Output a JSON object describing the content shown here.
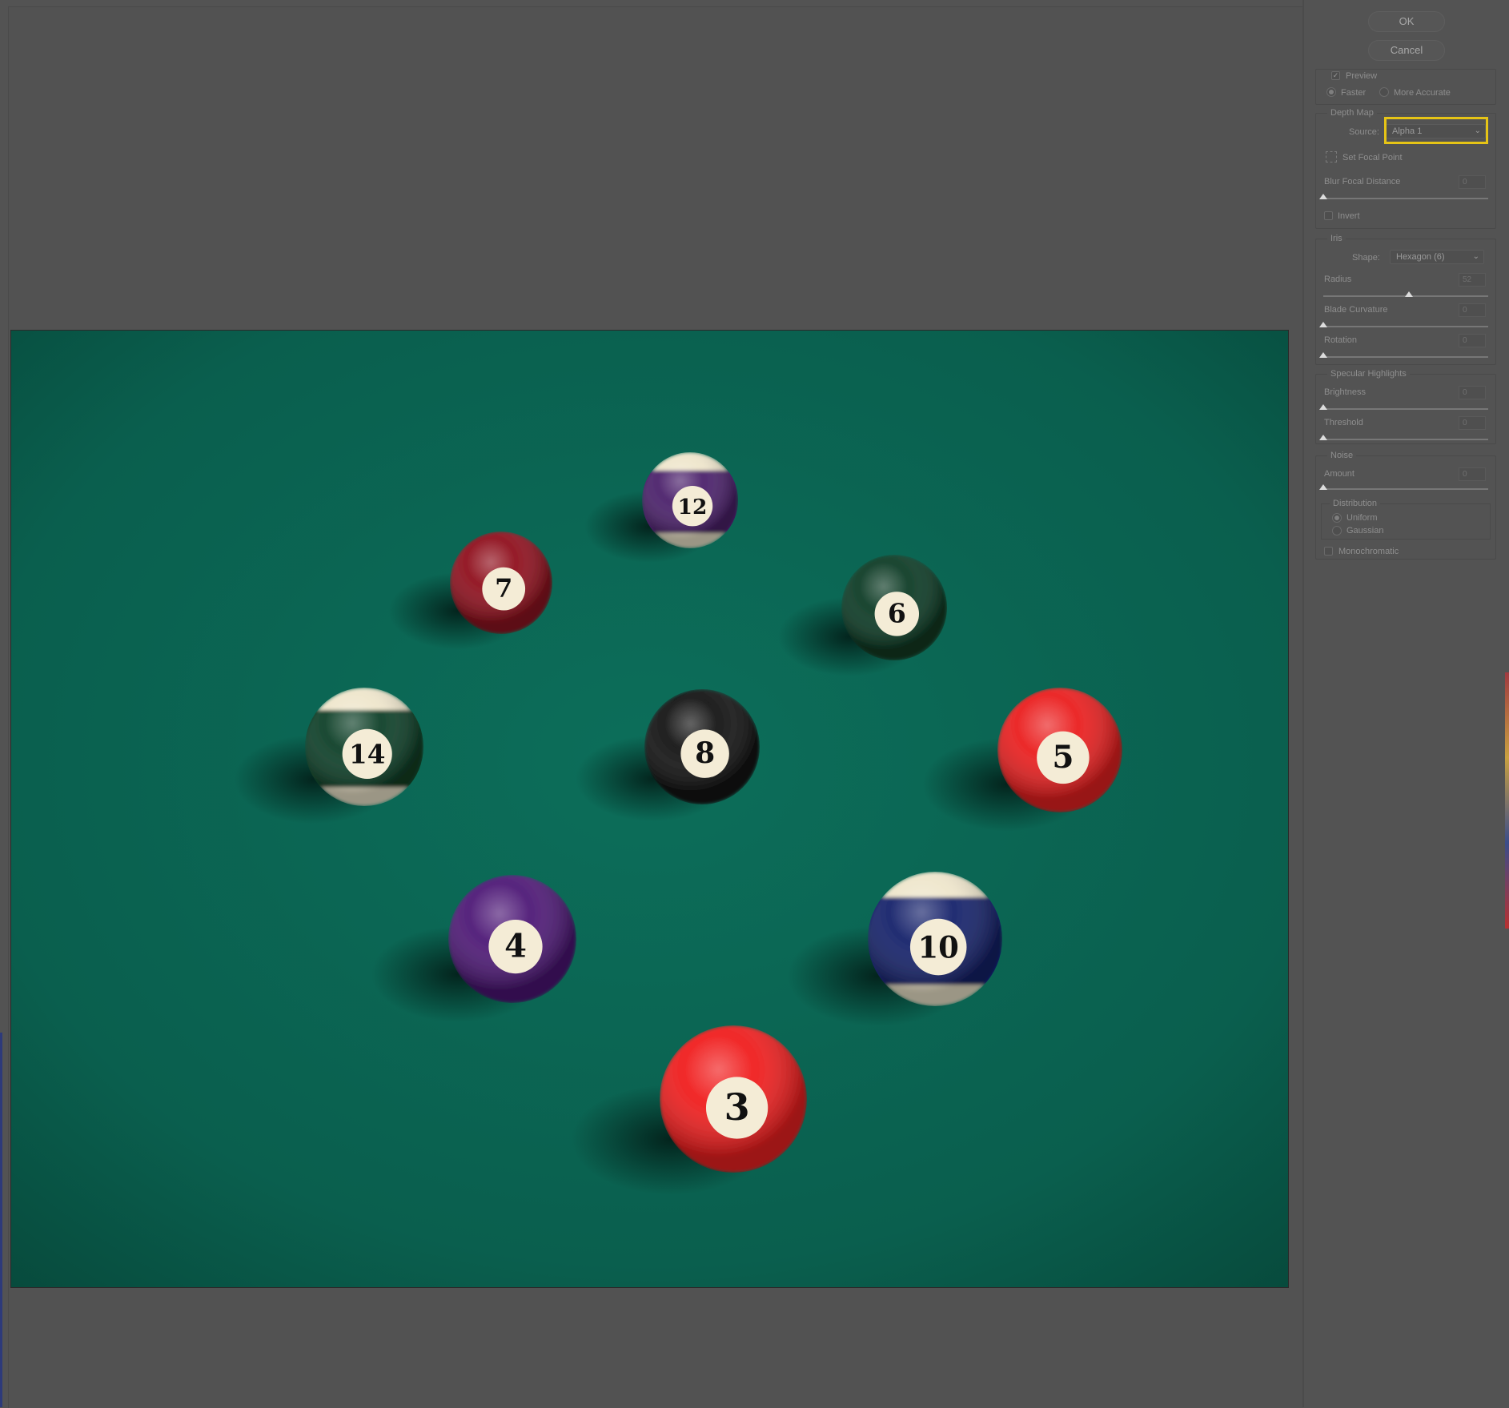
{
  "buttons": {
    "ok": "OK",
    "cancel": "Cancel"
  },
  "preview_group": {
    "preview_label": "Preview",
    "preview_checked": true,
    "faster_label": "Faster",
    "more_accurate_label": "More Accurate",
    "selected_mode": "Faster"
  },
  "depth_map": {
    "legend": "Depth Map",
    "source_label": "Source:",
    "source_value": "Alpha 1",
    "set_focal_point_label": "Set Focal Point",
    "blur_focal_distance_label": "Blur Focal Distance",
    "blur_focal_distance_value": "0",
    "invert_label": "Invert",
    "invert_checked": false
  },
  "iris": {
    "legend": "Iris",
    "shape_label": "Shape:",
    "shape_value": "Hexagon (6)",
    "radius_label": "Radius",
    "radius_value": "52",
    "blade_curvature_label": "Blade Curvature",
    "blade_curvature_value": "0",
    "rotation_label": "Rotation",
    "rotation_value": "0"
  },
  "specular_highlights": {
    "legend": "Specular Highlights",
    "brightness_label": "Brightness",
    "brightness_value": "0",
    "threshold_label": "Threshold",
    "threshold_value": "0"
  },
  "noise": {
    "legend": "Noise",
    "amount_label": "Amount",
    "amount_value": "0",
    "distribution_legend": "Distribution",
    "uniform_label": "Uniform",
    "gaussian_label": "Gaussian",
    "selected_distribution": "Uniform",
    "monochromatic_label": "Monochromatic",
    "monochromatic_checked": false
  },
  "preview_image": {
    "balls": [
      {
        "number": "12",
        "color": "#4a1f6a",
        "stripe": true
      },
      {
        "number": "7",
        "color": "#8f0f1c",
        "stripe": false
      },
      {
        "number": "6",
        "color": "#0c3a24",
        "stripe": false
      },
      {
        "number": "14",
        "color": "#0d3f27",
        "stripe": true
      },
      {
        "number": "8",
        "color": "#121212",
        "stripe": false
      },
      {
        "number": "5",
        "color": "#ea1e1e",
        "stripe": false
      },
      {
        "number": "4",
        "color": "#4d1876",
        "stripe": false
      },
      {
        "number": "10",
        "color": "#15216a",
        "stripe": true
      },
      {
        "number": "3",
        "color": "#f01c1c",
        "stripe": false
      }
    ],
    "felt_color": "#0b6a57"
  },
  "colors": {
    "highlight": "#e6c416",
    "panel_bg": "#535353"
  }
}
